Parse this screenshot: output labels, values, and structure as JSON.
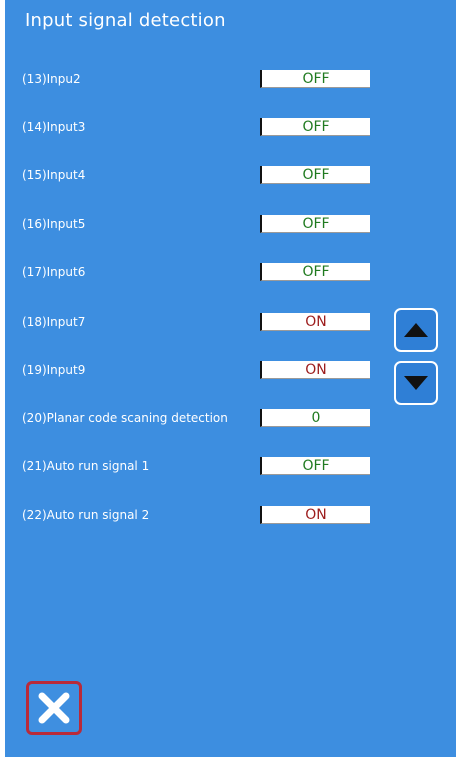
{
  "screen": {
    "title": "Input signal detection"
  },
  "rows": [
    {
      "label": "(13)Inpu2",
      "value": "OFF"
    },
    {
      "label": "(14)Input3",
      "value": "OFF"
    },
    {
      "label": "(15)Input4",
      "value": "OFF"
    },
    {
      "label": "(16)Input5",
      "value": "OFF"
    },
    {
      "label": "(17)Input6",
      "value": "OFF"
    },
    {
      "label": "(18)Input7",
      "value": "ON"
    },
    {
      "label": "(19)Input9",
      "value": "ON"
    },
    {
      "label": "(20)Planar code scaning detection",
      "value": "0"
    },
    {
      "label": "(21)Auto run signal 1",
      "value": "OFF"
    },
    {
      "label": "(22)Auto run signal 2",
      "value": "ON"
    }
  ],
  "controls": {
    "scroll_up_icon": "triangle-up-icon",
    "scroll_down_icon": "triangle-down-icon",
    "close_icon": "close-x-icon"
  },
  "colors": {
    "background": "#3d8ee0",
    "off_text": "#1f7a1f",
    "on_text": "#9c1c1c",
    "close_border": "#b92a3a"
  }
}
